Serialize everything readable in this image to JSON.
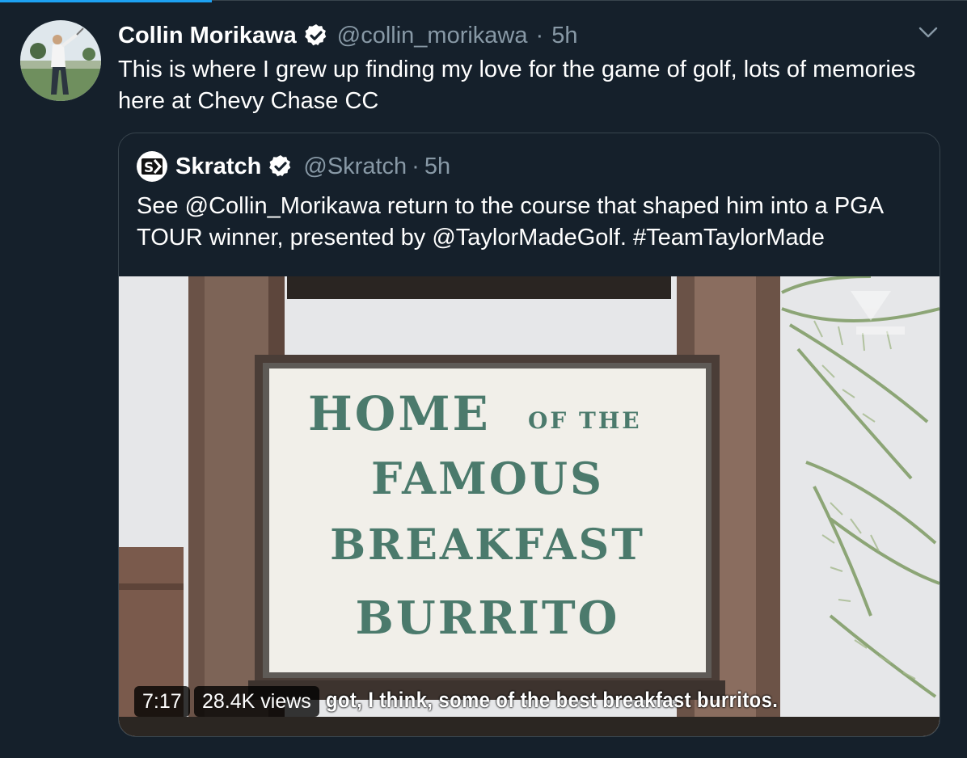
{
  "tweet": {
    "author_name": "Collin Morikawa",
    "author_handle": "@collin_morikawa",
    "separator": "·",
    "time": "5h",
    "text": "This is where I grew up finding my love for the game of golf, lots of memories here at Chevy Chase CC"
  },
  "quote": {
    "author_name": "Skratch",
    "author_handle": "@Skratch",
    "separator": "·",
    "time": "5h",
    "text": "See @Collin_Morikawa return to the course that shaped him into a PGA TOUR winner, presented by @TaylorMadeGolf. #TeamTaylorMade"
  },
  "video": {
    "sign_lines": [
      "HOME",
      "OF THE",
      "FAMOUS",
      "BREAKFAST",
      "BURRITO"
    ],
    "subtitle": "got, I think, some of the best breakfast burritos.",
    "duration": "7:17",
    "views": "28.4K views"
  },
  "icons": {
    "verified": "verified-badge-icon",
    "chevron": "chevron-down-icon",
    "logo": "skratch-logo-icon"
  },
  "colors": {
    "background": "#15202b",
    "text": "#ffffff",
    "muted": "#8899a6",
    "border": "#38444d",
    "accent": "#1da1f2",
    "sign_lettering": "#4b7a6c"
  }
}
